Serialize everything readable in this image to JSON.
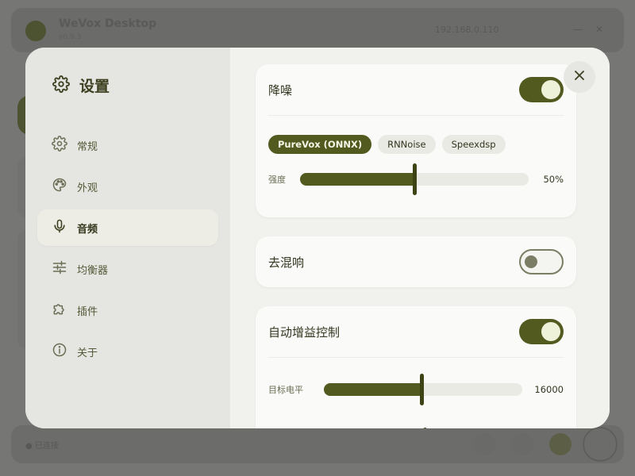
{
  "background": {
    "app_title": "WeVox Desktop",
    "app_subtitle": "v0.9.3",
    "ip": "192.168.0.110",
    "status": "● 已连接"
  },
  "settings": {
    "title": "设置",
    "nav": [
      {
        "label": "常规",
        "icon": "gear-icon"
      },
      {
        "label": "外观",
        "icon": "palette-icon"
      },
      {
        "label": "音频",
        "icon": "microphone-icon",
        "active": true
      },
      {
        "label": "均衡器",
        "icon": "sliders-icon"
      },
      {
        "label": "插件",
        "icon": "puzzle-icon"
      },
      {
        "label": "关于",
        "icon": "info-icon"
      }
    ]
  },
  "audio": {
    "denoise": {
      "title": "降噪",
      "enabled": true,
      "engines": [
        "PureVox (ONNX)",
        "RNNoise",
        "Speexdsp"
      ],
      "selected_engine": "PureVox (ONNX)",
      "strength_label": "强度",
      "strength_value": "50%",
      "strength_fraction": 0.5
    },
    "dereverb": {
      "title": "去混响",
      "enabled": false
    },
    "agc": {
      "title": "自动增益控制",
      "enabled": true,
      "target_label": "目标电平",
      "target_value": "16000",
      "target_fraction": 0.49
    }
  },
  "colors": {
    "accent": "#535a1f",
    "accent_dark": "#3e4316",
    "toggle_knob": "#eef2d8",
    "sidebar_bg": "#e5e5e1",
    "content_bg": "#f1f1ee"
  }
}
